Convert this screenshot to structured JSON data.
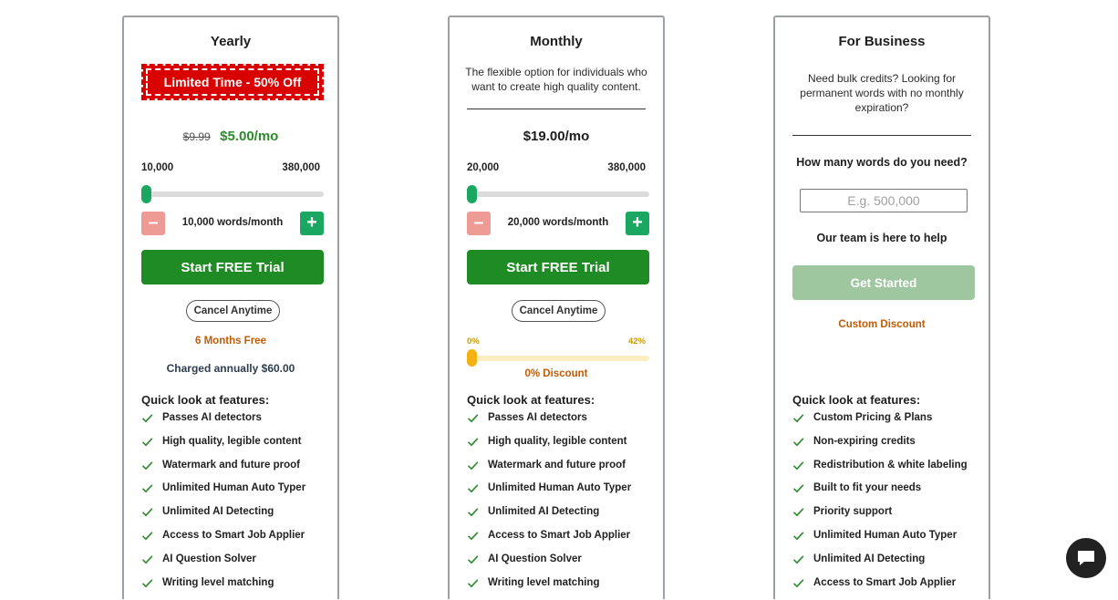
{
  "yearly": {
    "title": "Yearly",
    "promo": "Limited Time - 50% Off",
    "old_price": "$9.99",
    "price": "$5.00/mo",
    "range_min": "10,000",
    "range_max": "380,000",
    "slider_level": 0,
    "words": "10,000 words/month",
    "cta": "Start FREE Trial",
    "cancel": "Cancel Anytime",
    "months_free": "6 Months Free",
    "charged": "Charged annually $60.00",
    "features_heading": "Quick look at features:",
    "features": [
      "Passes AI detectors",
      "High quality, legible content",
      "Watermark and future proof",
      "Unlimited Human Auto Typer",
      "Unlimited AI Detecting",
      "Access to Smart Job Applier",
      "AI Question Solver",
      "Writing level matching"
    ]
  },
  "monthly": {
    "title": "Monthly",
    "description": "The flexible option for individuals who want to create high quality content.",
    "price": "$19.00/mo",
    "range_min": "20,000",
    "range_max": "380,000",
    "slider_level": 0,
    "words": "20,000 words/month",
    "cta": "Start FREE Trial",
    "cancel": "Cancel Anytime",
    "discount_min": "0%",
    "discount_max": "42%",
    "discount_level": 0,
    "discount": "0% Discount",
    "features_heading": "Quick look at features:",
    "features": [
      "Passes AI detectors",
      "High quality, legible content",
      "Watermark and future proof",
      "Unlimited Human Auto Typer",
      "Unlimited AI Detecting",
      "Access to Smart Job Applier",
      "AI Question Solver",
      "Writing level matching"
    ]
  },
  "business": {
    "title": "For Business",
    "description": "Need bulk credits? Looking for permanent words with no monthly expiration?",
    "question": "How many words do you need?",
    "input_placeholder": "E.g. 500,000",
    "help": "Our team is here to help",
    "cta": "Get Started",
    "custom_discount": "Custom Discount",
    "features_heading": "Quick look at features:",
    "features": [
      "Custom Pricing & Plans",
      "Non-expiring credits",
      "Redistribution & white labeling",
      "Built to fit your needs",
      "Priority support",
      "Unlimited Human Auto Typer",
      "Unlimited AI Detecting",
      "Access to Smart Job Applier"
    ]
  },
  "colors": {
    "green": "#1f8b24",
    "price_green": "#2c8a2c",
    "promo_red": "#d90000",
    "orange": "#c05c06",
    "slider_green": "#1aa761",
    "discount_yellow": "#f3b113"
  },
  "icons": {
    "check": "check-icon",
    "minus": "minus-icon",
    "plus": "plus-icon",
    "chat": "chat-icon"
  }
}
